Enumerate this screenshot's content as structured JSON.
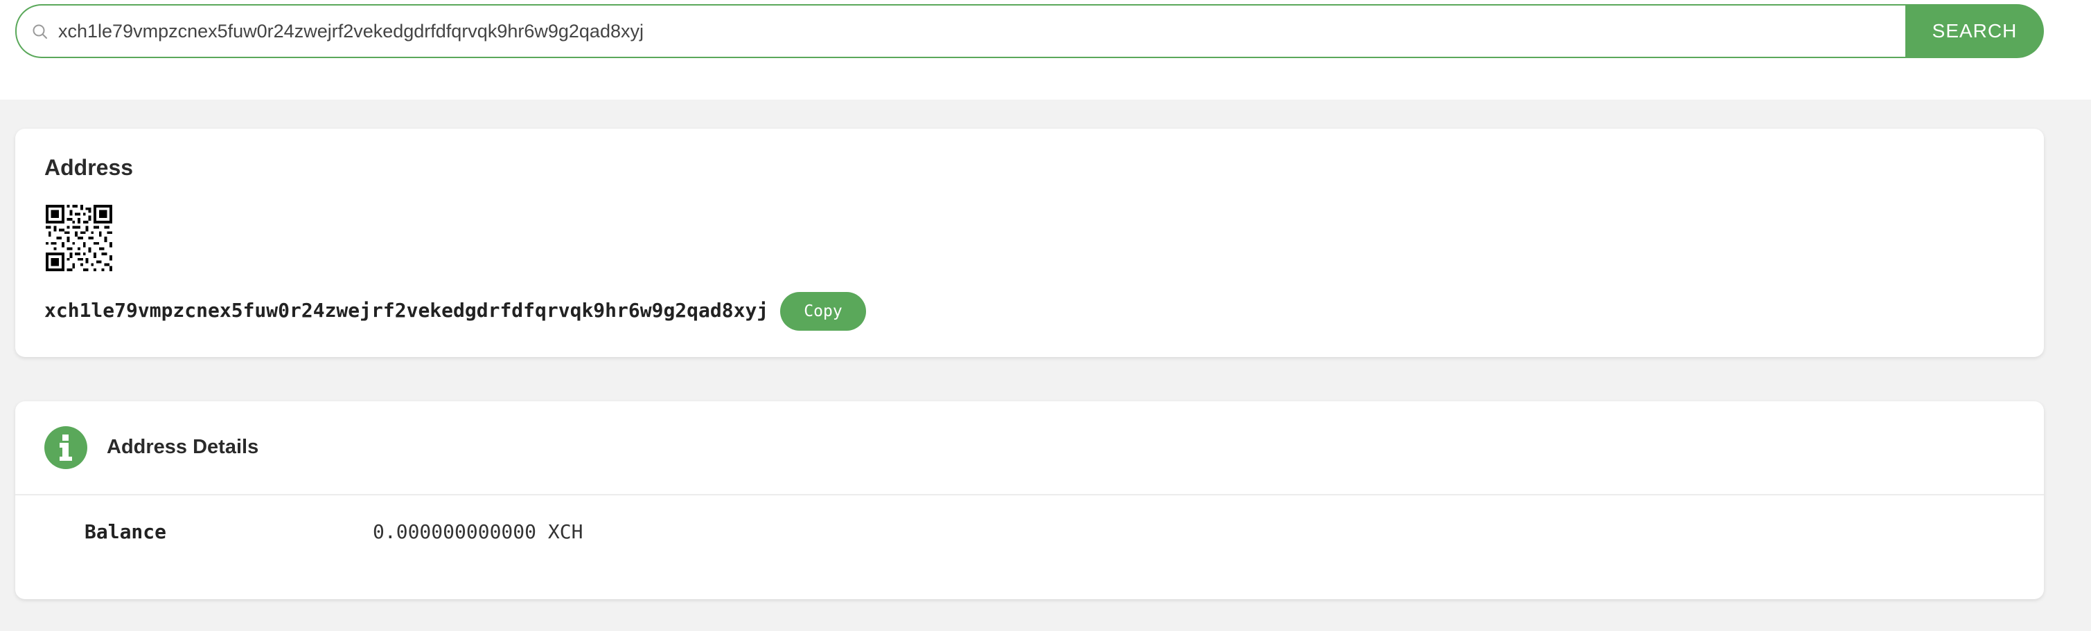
{
  "search": {
    "value": "xch1le79vmpzcnex5fuw0r24zwejrf2vekedgdrfdfqrvqk9hr6w9g2qad8xyj",
    "button_label": "SEARCH"
  },
  "address_card": {
    "title": "Address",
    "address": "xch1le79vmpzcnex5fuw0r24zwejrf2vekedgdrfdfqrvqk9hr6w9g2qad8xyj",
    "copy_label": "Copy"
  },
  "details_card": {
    "title": "Address Details",
    "rows": [
      {
        "label": "Balance",
        "value": "0.000000000000 XCH"
      }
    ]
  },
  "colors": {
    "accent": "#5aa85a",
    "page_bg": "#f2f2f2",
    "card_bg": "#ffffff"
  },
  "icons": [
    "search-icon",
    "qr-code",
    "info-icon"
  ]
}
